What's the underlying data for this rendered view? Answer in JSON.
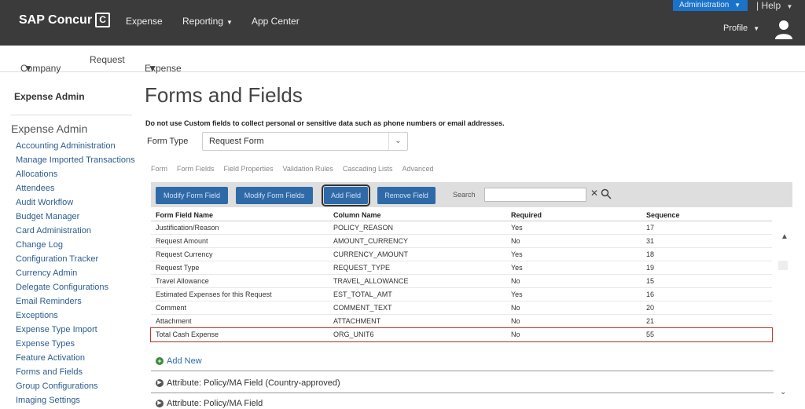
{
  "header": {
    "logo": "SAP Concur",
    "logo_mark": "C",
    "nav": [
      {
        "label": "Expense",
        "dropdown": false
      },
      {
        "label": "Reporting",
        "dropdown": true
      },
      {
        "label": "App Center",
        "dropdown": false
      }
    ],
    "top_right_button": "Administration",
    "help": "Help",
    "user": "Profile"
  },
  "subnav": [
    {
      "label": "Company",
      "dropdown": true
    },
    {
      "label": "Request",
      "dropdown": false
    },
    {
      "label": "Expense",
      "dropdown": true
    }
  ],
  "left_nav": {
    "admin_title": "Expense Admin",
    "section_title": "Expense Admin",
    "items": [
      "Accounting Administration",
      "Manage Imported Transactions",
      "Allocations",
      "Attendees",
      "Audit Workflow",
      "Budget Manager",
      "Card Administration",
      "Change Log",
      "Configuration Tracker",
      "Currency Admin",
      "Delegate Configurations",
      "Email Reminders",
      "Exceptions",
      "Expense Type Import",
      "Expense Types",
      "Feature Activation",
      "Forms and Fields",
      "Group Configurations",
      "Imaging Settings"
    ]
  },
  "main": {
    "title": "Forms and Fields",
    "warning": "Do not use Custom fields to collect personal or sensitive data such as phone numbers or email addresses.",
    "form_type_label": "Form Type",
    "form_type_value": "Request Form",
    "tabs": [
      "Form",
      "Form Fields",
      "Field Properties",
      "Validation Rules",
      "Cascading Lists",
      "Advanced"
    ],
    "toolbar": {
      "buttons": [
        "Modify Form Field",
        "Modify Form Fields",
        "Add Field",
        "Remove Field"
      ],
      "active_index": 2,
      "search_label": "Search",
      "search_value": ""
    },
    "columns": [
      "Form Field Name",
      "Column Name",
      "Required",
      "Sequence"
    ],
    "rows": [
      {
        "name": "Justification/Reason",
        "column": "POLICY_REASON",
        "required": "Yes",
        "sequence": "17",
        "selected": false
      },
      {
        "name": "Request Amount",
        "column": "AMOUNT_CURRENCY",
        "required": "No",
        "sequence": "31",
        "selected": false
      },
      {
        "name": "Request Currency",
        "column": "CURRENCY_AMOUNT",
        "required": "Yes",
        "sequence": "18",
        "selected": false
      },
      {
        "name": "Request Type",
        "column": "REQUEST_TYPE",
        "required": "Yes",
        "sequence": "19",
        "selected": false
      },
      {
        "name": "Travel Allowance",
        "column": "TRAVEL_ALLOWANCE",
        "required": "No",
        "sequence": "15",
        "selected": false
      },
      {
        "name": "Estimated Expenses for this Request",
        "column": "EST_TOTAL_AMT",
        "required": "Yes",
        "sequence": "16",
        "selected": false
      },
      {
        "name": "Comment",
        "column": "COMMENT_TEXT",
        "required": "No",
        "sequence": "20",
        "selected": false
      },
      {
        "name": "Attachment",
        "column": "ATTACHMENT",
        "required": "No",
        "sequence": "21",
        "selected": false
      },
      {
        "name": "Total Cash Expense",
        "column": "ORG_UNIT6",
        "required": "No",
        "sequence": "55",
        "selected": true
      }
    ],
    "add_new": "Add New",
    "sections": [
      "Attribute: Policy/MA Field (Country-approved)",
      "Attribute: Policy/MA Field"
    ]
  }
}
